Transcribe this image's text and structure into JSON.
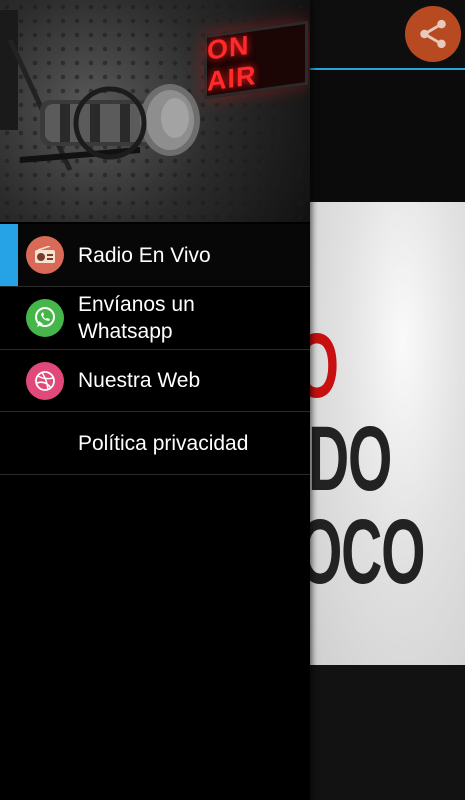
{
  "toolbar": {
    "share_icon": "share-icon"
  },
  "poster": {
    "line1": "IO",
    "line2": "DO",
    "line3": "OCO"
  },
  "header": {
    "sign_text": "ON AIR"
  },
  "menu": {
    "items": [
      {
        "label": "Radio En Vivo",
        "icon": "radio-icon",
        "icon_color": "#d96a57",
        "active": true
      },
      {
        "label": "Envíanos un\nWhatsapp",
        "icon": "whatsapp-icon",
        "icon_color": "#47b64a"
      },
      {
        "label": "Nuestra Web",
        "icon": "dribbble-icon",
        "icon_color": "#e0497a"
      },
      {
        "label": "Política privacidad"
      }
    ]
  },
  "colors": {
    "accent": "#25a3e6",
    "share_bg": "#b84a22"
  }
}
